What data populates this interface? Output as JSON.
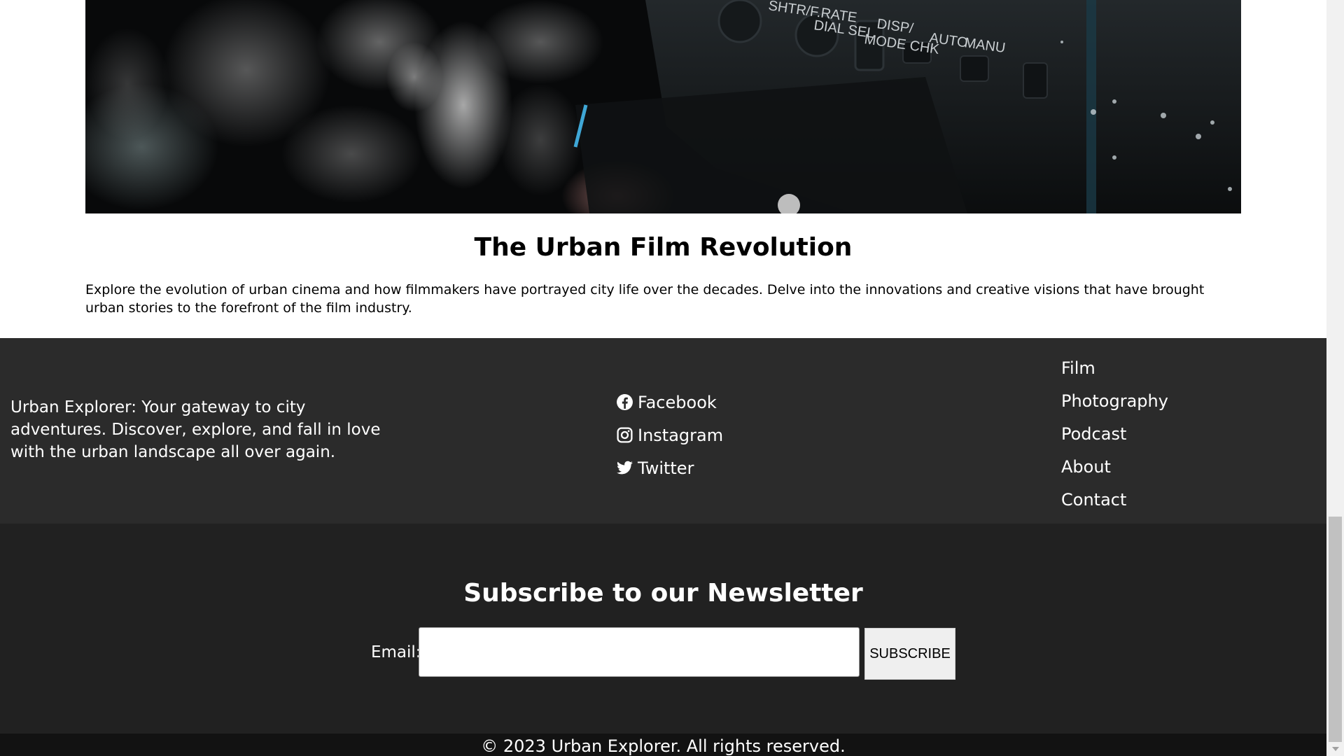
{
  "hero": {
    "image_alt": "Close-up of a camcorder control panel",
    "camera_labels": [
      "SHTR/F.RATE",
      "DIAL SEL",
      "DISP/",
      "MODE CHK",
      "AUTO",
      "MANU"
    ]
  },
  "article": {
    "title": "The Urban Film Revolution",
    "text": "Explore the evolution of urban cinema and how filmmakers have portrayed city life over the decades. Delve into the innovations and creative visions that have brought urban stories to the forefront of the film industry."
  },
  "footer": {
    "about": "Urban Explorer: Your gateway to city adventures. Discover, explore, and fall in love with the urban landscape all over again.",
    "social": [
      {
        "label": "Facebook",
        "icon": "facebook-icon"
      },
      {
        "label": "Instagram",
        "icon": "instagram-icon"
      },
      {
        "label": "Twitter",
        "icon": "twitter-icon"
      }
    ],
    "nav": [
      "Film",
      "Photography",
      "Podcast",
      "About",
      "Contact"
    ]
  },
  "newsletter": {
    "title": "Subscribe to our Newsletter",
    "email_label": "Email:",
    "email_value": "",
    "button_label": "SUBSCRIBE"
  },
  "copyright": "© 2023 Urban Explorer. All rights reserved.",
  "colors": {
    "footer_bg": "#2b2b2b",
    "newsletter_bg": "#212121",
    "copyright_bg": "#121212"
  }
}
